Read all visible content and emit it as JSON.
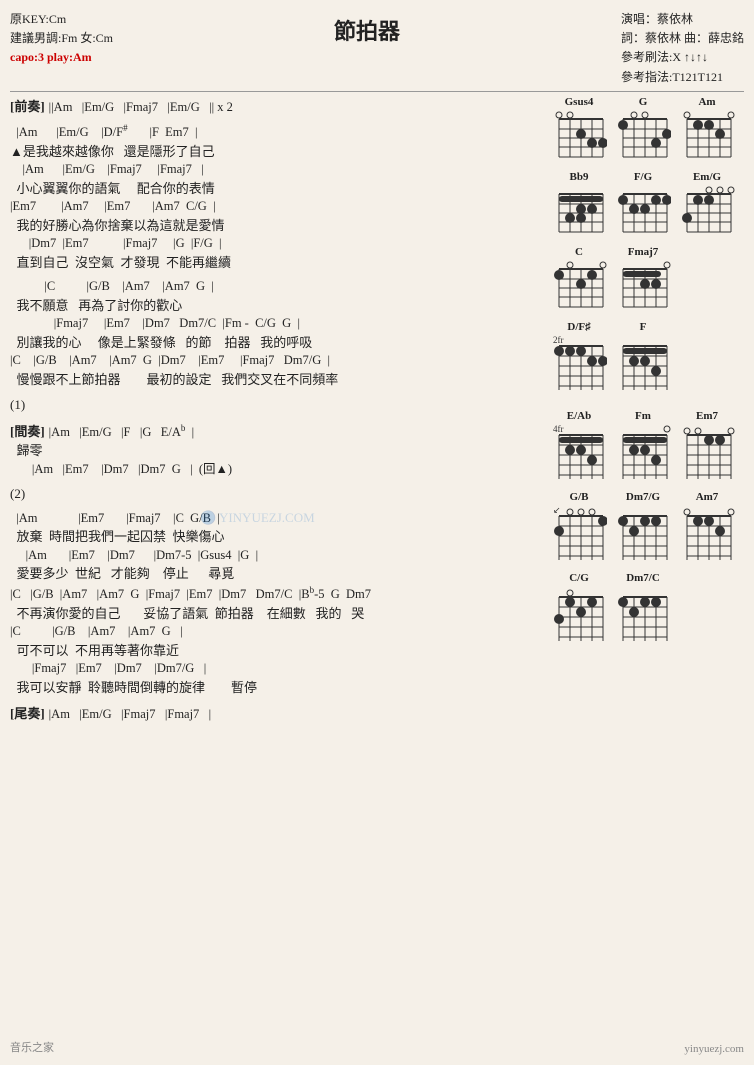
{
  "header": {
    "title": "節拍器",
    "left": {
      "key": "原KEY:Cm",
      "suggest": "建議男調:Fm 女:Cm",
      "capo": "capo:3 play:Am"
    },
    "right": {
      "singer": "演唱：蔡依林",
      "lyricist": "詞：蔡依林  曲：薛忠銘",
      "strum": "參考刷法:X ↑↓↑↓",
      "fingering": "參考指法:T121T121"
    }
  },
  "sections": [
    {
      "type": "intro",
      "chords": "||Am   |Em/G   |Fmaj7   |Em/G   || x 2",
      "label": "[前奏]"
    },
    {
      "type": "spacer"
    },
    {
      "type": "chords",
      "text": "  |Am      |Em/G    |D/F♯       |F  Em7  |"
    },
    {
      "type": "lyrics",
      "text": "▲是我越來越像你   還是隱形了自己"
    },
    {
      "type": "chords",
      "text": "    |Am      |Em/G    |Fmaj7     |Fmaj7   |"
    },
    {
      "type": "lyrics",
      "text": "  小心翼翼你的語氣     配合你的表情"
    },
    {
      "type": "chords",
      "text": "|Em7        |Am7     |Em7       |Am7  C/G  |"
    },
    {
      "type": "lyrics",
      "text": "  我的好勝心為你捨棄以為這就是愛情"
    },
    {
      "type": "chords",
      "text": "      |Dm7  |Em7           |Fmaj7     |G  |F/G  |"
    },
    {
      "type": "lyrics",
      "text": "  直到自己  沒空氣  才發現  不能再繼續"
    },
    {
      "type": "spacer"
    },
    {
      "type": "chords",
      "text": "           |C          |G/B    |Am7    |Am7  G  |"
    },
    {
      "type": "lyrics",
      "text": "  我不願意   再為了討你的歡心"
    },
    {
      "type": "chords",
      "text": "              |Fmaj7     |Em7    |Dm7   Dm7/C  |Fm -  C/G  G  |"
    },
    {
      "type": "lyrics",
      "text": "  別讓我的心     像是上緊發條   的節    拍器   我的呼吸"
    },
    {
      "type": "chords",
      "text": "|C    |G/B    |Am7    |Am7  G  |Dm7    |Em7     |Fmaj7   Dm7/G  |"
    },
    {
      "type": "lyrics",
      "text": "  慢慢跟不上節拍器        最初的設定   我們交叉在不同頻率"
    },
    {
      "type": "spacer"
    },
    {
      "type": "marker",
      "text": "(1)"
    },
    {
      "type": "spacer"
    },
    {
      "type": "chords",
      "text": "[間奏] |Am   |Em/G   |F   |G   E/Ab  |"
    },
    {
      "type": "lyrics",
      "text": "  歸零"
    },
    {
      "type": "chords",
      "text": "       |Am   |Em7    |Dm7   |Dm7  G   |  (回▲)"
    },
    {
      "type": "spacer"
    },
    {
      "type": "marker",
      "text": "(2)"
    },
    {
      "type": "spacer"
    },
    {
      "type": "chords",
      "text": "  |Am             |Em7       |Fmaj7    |C  G/B  |"
    },
    {
      "type": "lyrics",
      "text": "  放棄  時間把我們一起囚禁  快樂傷心"
    },
    {
      "type": "chords",
      "text": "     |Am       |Em7    |Dm7      |Dm7-5  |Gsus4  |G  |"
    },
    {
      "type": "lyrics",
      "text": "  愛要多少  世紀   才能夠    停止      尋覓"
    },
    {
      "type": "chords",
      "text": "|C    |G/B    |Am7    |Am7  G   |Fmaj7   |Em7    |Dm7    Dm7/C   |Bb-5  G  Dm7"
    },
    {
      "type": "lyrics",
      "text": "  不再演你愛的自己       妥協了語氣  節拍器    在細數   我的   哭"
    },
    {
      "type": "chords",
      "text": "|C          |G/B    |Am7    |Am7  G   |"
    },
    {
      "type": "lyrics",
      "text": "  可不可以  不用再等著你靠近"
    },
    {
      "type": "chords",
      "text": "       |Fmaj7   |Em7    |Dm7    |Dm7/G   |"
    },
    {
      "type": "lyrics",
      "text": "  我可以安靜  聆聽時間倒轉的旋律        暫停"
    },
    {
      "type": "spacer"
    },
    {
      "type": "outro",
      "label": "[尾奏]",
      "chords": "|Am   |Em/G   |Fmaj7   |Fmaj7   |"
    }
  ],
  "chordDiagrams": [
    {
      "name": "Gsus4",
      "fret": 0,
      "fingers": [
        [
          1,
          3
        ],
        [
          2,
          3
        ],
        [
          3,
          4
        ],
        [
          4,
          5
        ]
      ],
      "openStrings": [
        0,
        0
      ]
    },
    {
      "name": "G",
      "fret": 0,
      "fingers": [
        [
          1,
          2
        ],
        [
          5,
          3
        ],
        [
          6,
          3
        ]
      ],
      "openStrings": [
        0,
        1
      ]
    },
    {
      "name": "Am",
      "fret": 0,
      "openStrings": [
        0,
        1
      ]
    },
    {
      "name": "Bb9",
      "fret": 0
    },
    {
      "name": "F/G",
      "fret": 0
    },
    {
      "name": "Em/G",
      "fret": 0,
      "openStrings": [
        0,
        0,
        0
      ]
    },
    {
      "name": "C",
      "fret": 0,
      "openStrings": [
        0,
        1
      ]
    },
    {
      "name": "Fmaj7",
      "fret": 0
    },
    {
      "name": "D/F♯",
      "fret": 0
    },
    {
      "name": "F",
      "fret": 0
    },
    {
      "name": "E/Ab",
      "fret": 0
    },
    {
      "name": "Fm",
      "fret": 0
    },
    {
      "name": "Em7",
      "fret": 0
    },
    {
      "name": "G/B",
      "fret": 0
    },
    {
      "name": "Dm7/G",
      "fret": 0
    },
    {
      "name": "Am7",
      "fret": 0
    },
    {
      "name": "C/G",
      "fret": 0
    },
    {
      "name": "Dm7/C",
      "fret": 0
    }
  ]
}
